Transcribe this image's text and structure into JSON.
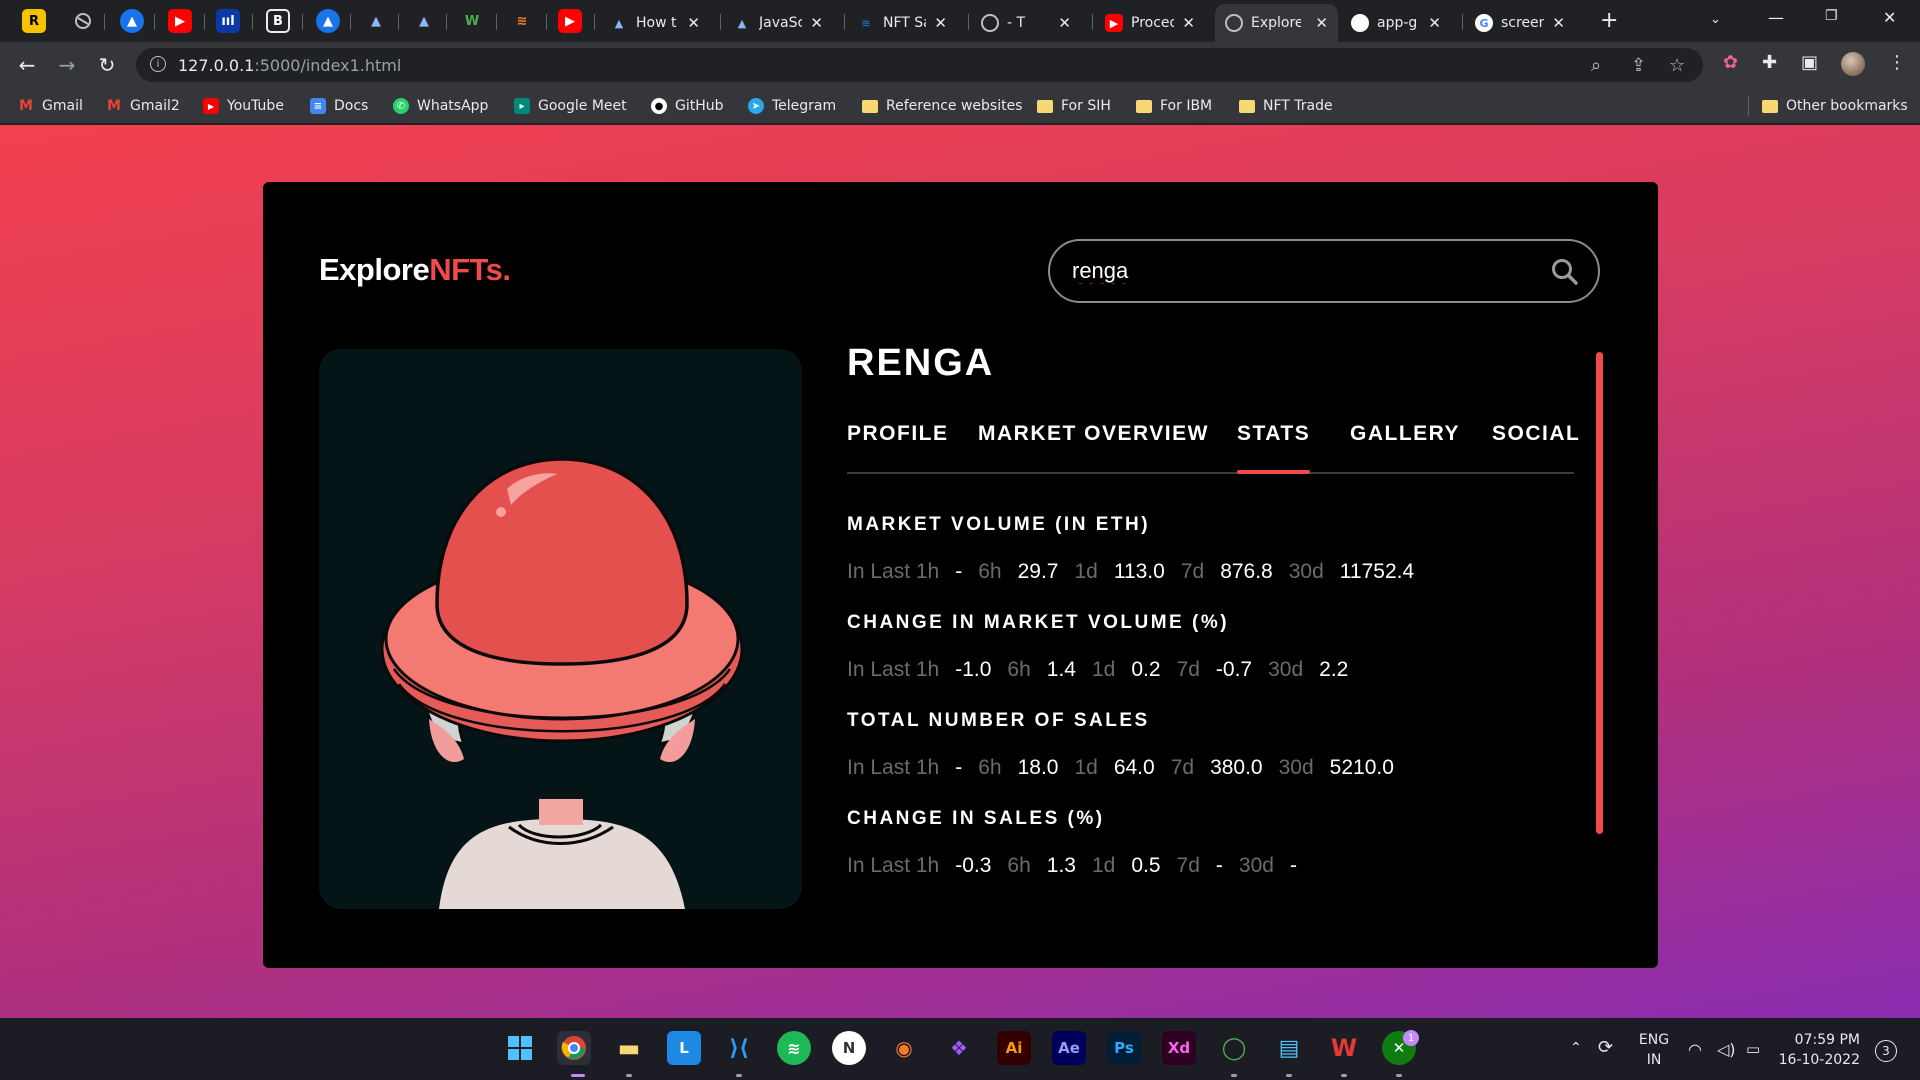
{
  "browser": {
    "tabs": [
      {
        "label": "How t",
        "icon_color": "#4285f4"
      },
      {
        "label": "JavaSc",
        "icon_color": "#4285f4"
      },
      {
        "label": "NFT Sa",
        "icon_color": "#2081e2"
      },
      {
        "label": "- T",
        "icon_color": "#9aa0a6"
      },
      {
        "label": "Proced",
        "icon_color": "#ff0000"
      },
      {
        "label": "Explore",
        "icon_color": "#9aa0a6"
      },
      {
        "label": "app-g",
        "icon_color": "#ffffff"
      },
      {
        "label": "screen",
        "icon_color": "#4285f4"
      }
    ],
    "url": {
      "host": "127.0.0.1",
      "path": ":5000/index1.html"
    },
    "bookmarks": [
      {
        "label": "Gmail",
        "icon": "gmail-icon",
        "color": "#ea4335"
      },
      {
        "label": "Gmail2",
        "icon": "gmail-icon",
        "color": "#ea4335"
      },
      {
        "label": "YouTube",
        "icon": "youtube-icon",
        "color": "#ff0000"
      },
      {
        "label": "Docs",
        "icon": "docs-icon",
        "color": "#4285f4"
      },
      {
        "label": "WhatsApp",
        "icon": "whatsapp-icon",
        "color": "#25d366"
      },
      {
        "label": "Google Meet",
        "icon": "meet-icon",
        "color": "#00897b"
      },
      {
        "label": "GitHub",
        "icon": "github-icon",
        "color": "#ffffff"
      },
      {
        "label": "Telegram",
        "icon": "telegram-icon",
        "color": "#29a9eb"
      },
      {
        "label": "Reference websites",
        "icon": "folder-icon",
        "color": "#f8d775"
      },
      {
        "label": "For SIH",
        "icon": "folder-icon",
        "color": "#f8d775"
      },
      {
        "label": "For IBM",
        "icon": "folder-icon",
        "color": "#f8d775"
      },
      {
        "label": "NFT Trade",
        "icon": "folder-icon",
        "color": "#f8d775"
      }
    ],
    "other_bookmarks": "Other bookmarks"
  },
  "page": {
    "brand_part1": "Explore",
    "brand_part2": "NFTs.",
    "search_value": "renga",
    "collection_title": "RENGA",
    "nav_tabs": [
      "PROFILE",
      "MARKET OVERVIEW",
      "STATS",
      "GALLERY",
      "SOCIAL"
    ],
    "active_tab": "STATS",
    "stats": [
      {
        "heading": "MARKET VOLUME (IN ETH)",
        "row": [
          {
            "label": "In Last 1h",
            "value": "-"
          },
          {
            "label": "6h",
            "value": "29.7"
          },
          {
            "label": "1d",
            "value": "113.0"
          },
          {
            "label": "7d",
            "value": "876.8"
          },
          {
            "label": "30d",
            "value": "11752.4"
          }
        ]
      },
      {
        "heading": "CHANGE IN MARKET VOLUME (%)",
        "row": [
          {
            "label": "In Last 1h",
            "value": "-1.0"
          },
          {
            "label": "6h",
            "value": "1.4"
          },
          {
            "label": "1d",
            "value": "0.2"
          },
          {
            "label": "7d",
            "value": "-0.7"
          },
          {
            "label": "30d",
            "value": "2.2"
          }
        ]
      },
      {
        "heading": "TOTAL NUMBER OF SALES",
        "row": [
          {
            "label": "In Last 1h",
            "value": "-"
          },
          {
            "label": "6h",
            "value": "18.0"
          },
          {
            "label": "1d",
            "value": "64.0"
          },
          {
            "label": "7d",
            "value": "380.0"
          },
          {
            "label": "30d",
            "value": "5210.0"
          }
        ]
      },
      {
        "heading": "CHANGE IN SALES (%)",
        "row": [
          {
            "label": "In Last 1h",
            "value": "-0.3"
          },
          {
            "label": "6h",
            "value": "1.3"
          },
          {
            "label": "1d",
            "value": "0.5"
          },
          {
            "label": "7d",
            "value": "-"
          },
          {
            "label": "30d",
            "value": "-"
          }
        ]
      }
    ]
  },
  "taskbar": {
    "language_line1": "ENG",
    "language_line2": "IN",
    "time": "07:59 PM",
    "date": "16-10-2022",
    "notifications": "3",
    "xbox_badge": "1"
  },
  "colors": {
    "accent": "#f04a4a",
    "card_bg": "#000000",
    "art_bg": "#051417"
  }
}
